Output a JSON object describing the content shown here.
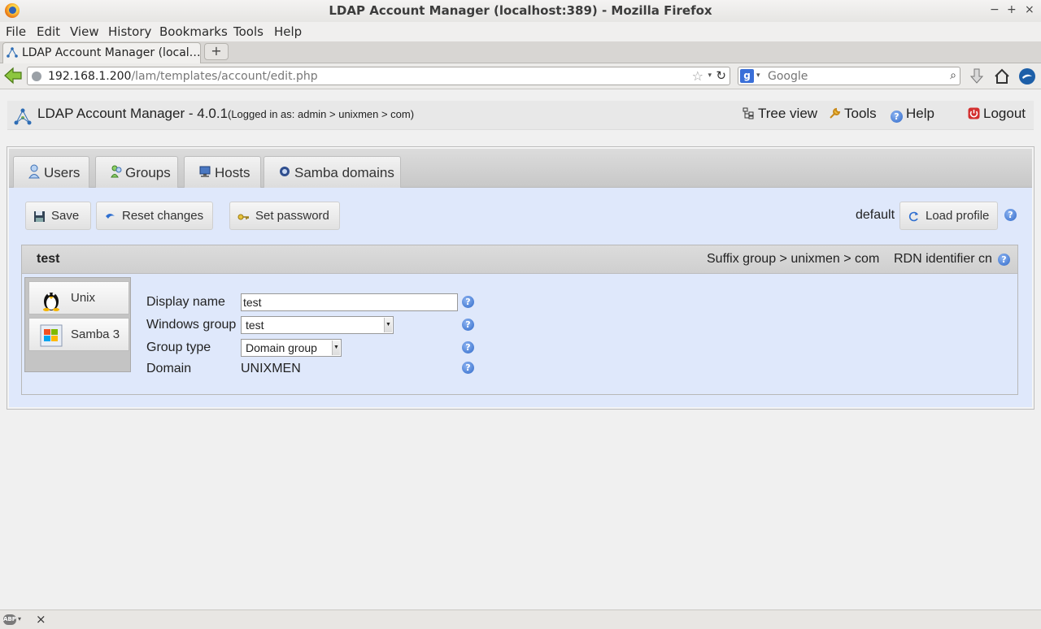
{
  "window": {
    "title": "LDAP Account Manager (localhost:389) - Mozilla Firefox",
    "minimize": "−",
    "maximize": "+",
    "close": "×"
  },
  "menu": {
    "file": "File",
    "edit": "Edit",
    "view": "View",
    "history": "History",
    "bookmarks": "Bookmarks",
    "tools": "Tools",
    "help": "Help"
  },
  "browser_tab": {
    "label": "LDAP Account Manager (local…",
    "new_tab": "+"
  },
  "address": {
    "host": "192.168.1.200",
    "path": "/lam/templates/account/edit.php",
    "star": "☆",
    "dropdown": "▾",
    "reload": "↻"
  },
  "search": {
    "engine": "g",
    "placeholder": "Google",
    "button": "⌕"
  },
  "lam": {
    "app_title": "LDAP Account Manager - 4.0.1",
    "login_info": "(Logged in as: admin > unixmen > com)",
    "tree_view": "Tree view",
    "tools": "Tools",
    "help": "Help",
    "logout": "Logout"
  },
  "tabs": {
    "users": "Users",
    "groups": "Groups",
    "hosts": "Hosts",
    "samba_domains": "Samba domains"
  },
  "toolbar": {
    "save": "Save",
    "reset": "Reset changes",
    "set_password": "Set password",
    "profile_name": "default",
    "load_profile": "Load profile"
  },
  "account": {
    "name": "test",
    "suffix": "Suffix group > unixmen > com",
    "rdn": "RDN identifier cn"
  },
  "modules": {
    "unix": "Unix",
    "samba3": "Samba 3"
  },
  "form": {
    "display_name_label": "Display name",
    "display_name_value": "test",
    "windows_group_label": "Windows group",
    "windows_group_value": "test",
    "group_type_label": "Group type",
    "group_type_value": "Domain group",
    "domain_label": "Domain",
    "domain_value": "UNIXMEN"
  },
  "statusbar": {
    "abp": "ABP",
    "close": "×"
  },
  "help_glyph": "?"
}
